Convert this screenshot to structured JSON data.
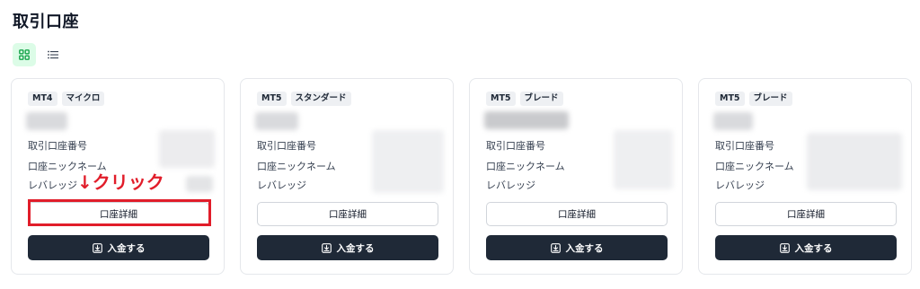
{
  "page": {
    "title": "取引口座"
  },
  "view_toggle": {
    "grid_icon": "grid-icon",
    "list_icon": "list-icon",
    "active": "grid"
  },
  "labels": {
    "account_number": "取引口座番号",
    "nickname": "口座ニックネーム",
    "leverage": "レバレッジ",
    "detail_button": "口座詳細",
    "deposit_button": "入金する"
  },
  "accounts": [
    {
      "platform": "MT4",
      "type": "マイクロ"
    },
    {
      "platform": "MT5",
      "type": "スタンダード"
    },
    {
      "platform": "MT5",
      "type": "ブレード"
    },
    {
      "platform": "MT5",
      "type": "ブレード"
    }
  ],
  "annotation": {
    "text": "↓クリック",
    "color": "#e11d2a"
  },
  "colors": {
    "primary_dark": "#1f2937",
    "accent_green": "#16a34a",
    "annotation_red": "#e11d2a"
  }
}
